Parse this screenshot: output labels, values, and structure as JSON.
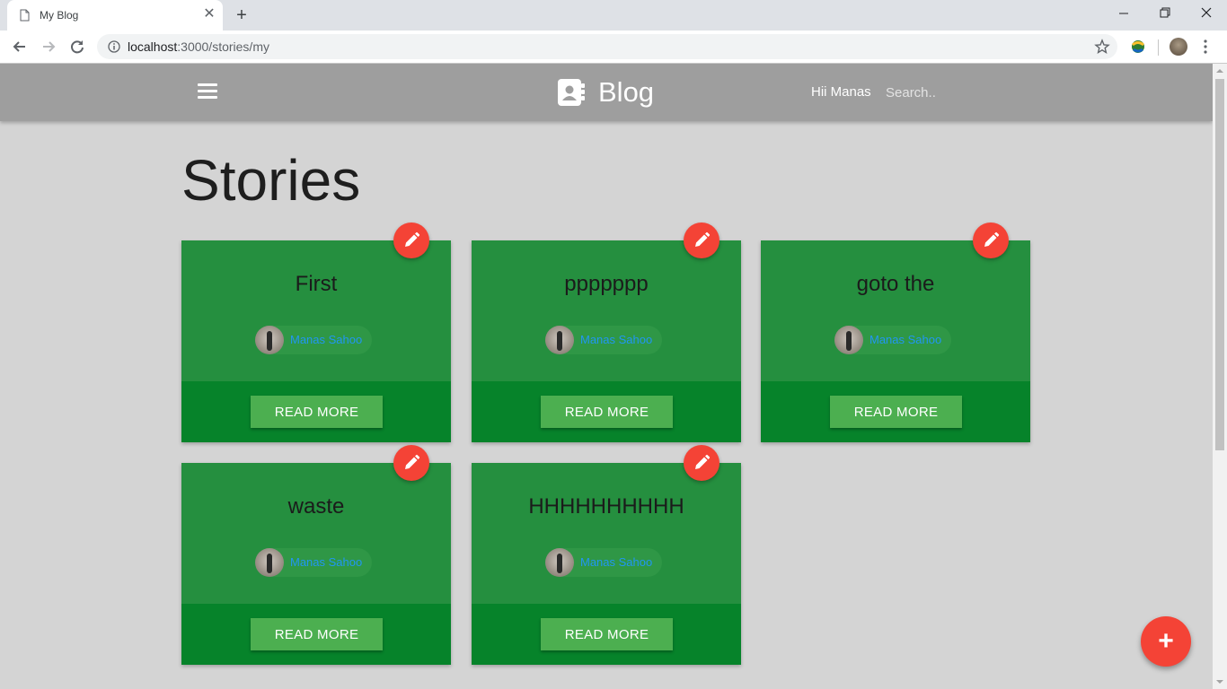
{
  "browser": {
    "tab_title": "My Blog",
    "url_host": "localhost",
    "url_path": ":3000/stories/my",
    "new_tab_symbol": "+",
    "close_tab_symbol": "✕"
  },
  "navbar": {
    "brand": "Blog",
    "greeting": "Hii Manas",
    "search_placeholder": "Search.."
  },
  "page": {
    "heading": "Stories"
  },
  "stories": [
    {
      "title": "First",
      "author": "Manas Sahoo",
      "button": "READ MORE"
    },
    {
      "title": "ppppppp",
      "author": "Manas Sahoo",
      "button": "READ MORE"
    },
    {
      "title": "goto the",
      "author": "Manas Sahoo",
      "button": "READ MORE"
    },
    {
      "title": "waste",
      "author": "Manas Sahoo",
      "button": "READ MORE"
    },
    {
      "title": "HHHHHHHHHH",
      "author": "Manas Sahoo",
      "button": "READ MORE"
    }
  ],
  "fab": {
    "symbol": "+"
  },
  "colors": {
    "navbar": "#9e9e9e",
    "card_top": "#258f3f",
    "card_bottom": "#06832a",
    "button": "#4caf50",
    "accent_red": "#f44336",
    "author_link": "#2196f3"
  }
}
